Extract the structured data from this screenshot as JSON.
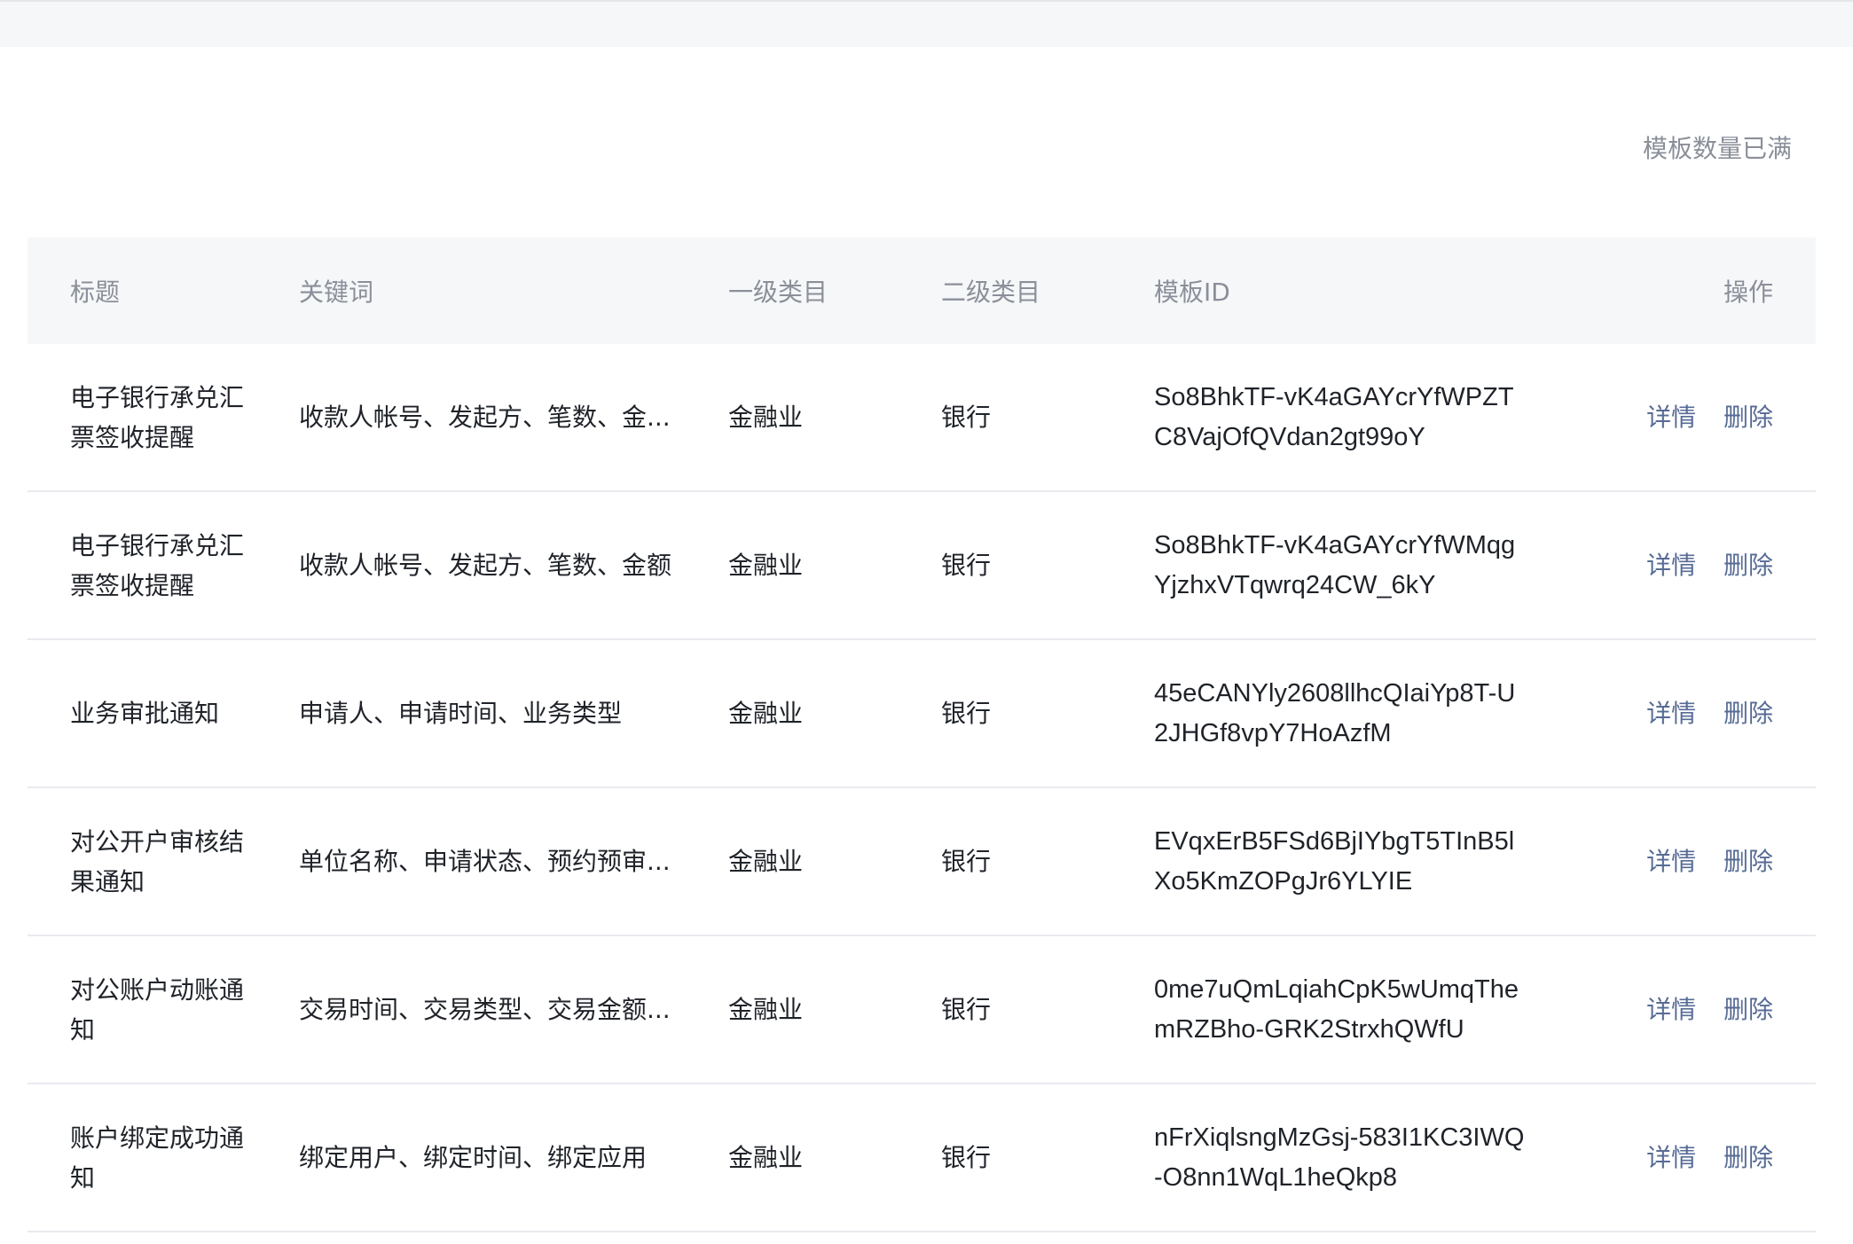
{
  "quota_status": "模板数量已满",
  "table": {
    "headers": {
      "title": "标题",
      "keywords": "关键词",
      "category_1": "一级类目",
      "category_2": "二级类目",
      "template_id": "模板ID",
      "actions": "操作"
    },
    "rows": [
      {
        "title": "电子银行承兑汇票签收提醒",
        "keywords": "收款人帐号、发起方、笔数、金...",
        "category_1": "金融业",
        "category_2": "银行",
        "template_id": "So8BhkTF-vK4aGAYcrYfWPZTC8VajOfQVdan2gt99oY",
        "detail_label": "详情",
        "delete_label": "删除"
      },
      {
        "title": "电子银行承兑汇票签收提醒",
        "keywords": "收款人帐号、发起方、笔数、金额",
        "category_1": "金融业",
        "category_2": "银行",
        "template_id": "So8BhkTF-vK4aGAYcrYfWMqgYjzhxVTqwrq24CW_6kY",
        "detail_label": "详情",
        "delete_label": "删除"
      },
      {
        "title": "业务审批通知",
        "keywords": "申请人、申请时间、业务类型",
        "category_1": "金融业",
        "category_2": "银行",
        "template_id": "45eCANYly2608llhcQIaiYp8T-U2JHGf8vpY7HoAzfM",
        "detail_label": "详情",
        "delete_label": "删除"
      },
      {
        "title": "对公开户审核结果通知",
        "keywords": "单位名称、申请状态、预约预审...",
        "category_1": "金融业",
        "category_2": "银行",
        "template_id": "EVqxErB5FSd6BjIYbgT5TInB5lXo5KmZOPgJr6YLYIE",
        "detail_label": "详情",
        "delete_label": "删除"
      },
      {
        "title": "对公账户动账通知",
        "keywords": "交易时间、交易类型、交易金额...",
        "category_1": "金融业",
        "category_2": "银行",
        "template_id": "0me7uQmLqiahCpK5wUmqThemRZBho-GRK2StrxhQWfU",
        "detail_label": "详情",
        "delete_label": "删除"
      },
      {
        "title": "账户绑定成功通知",
        "keywords": "绑定用户、绑定时间、绑定应用",
        "category_1": "金融业",
        "category_2": "银行",
        "template_id": "nFrXiqlsngMzGsj-583I1KC3IWQ-O8nn1WqL1heQkp8",
        "detail_label": "详情",
        "delete_label": "删除"
      }
    ]
  },
  "colors": {
    "link": "#576b95",
    "header_bg": "#f6f7f9",
    "muted_text": "#8a8f99",
    "body_text": "#1f2329",
    "row_divider": "#e8eaee"
  }
}
